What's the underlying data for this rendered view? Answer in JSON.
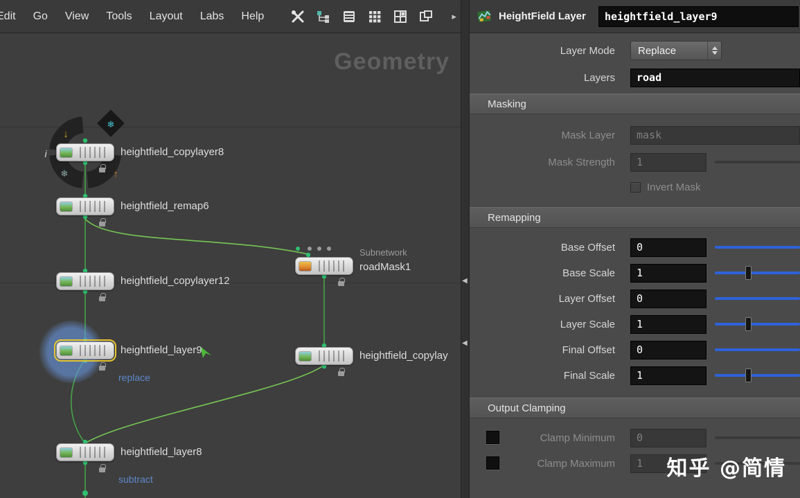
{
  "menu": {
    "items": [
      "Edit",
      "Go",
      "View",
      "Tools",
      "Layout",
      "Labs",
      "Help"
    ]
  },
  "icons": {
    "arrow_down": "↓",
    "arrow_up": "↑",
    "freeze": "❄",
    "info": "i",
    "overflow_chevron": "▸",
    "divider_arrow": "◀"
  },
  "network": {
    "watermark": "Geometry",
    "nodes": {
      "copylayer8": {
        "label": "heightfield_copylayer8"
      },
      "remap6": {
        "label": "heightfield_remap6"
      },
      "copylayer12": {
        "label": "heightfield_copylayer12"
      },
      "roadmask1": {
        "type_label": "Subnetwork",
        "label": "roadMask1"
      },
      "layer9": {
        "label": "heightfield_layer9",
        "mode_label": "replace"
      },
      "copylayer_right": {
        "label": "heightfield_copylay"
      },
      "layer8": {
        "label": "heightfield_layer8",
        "mode_label": "subtract"
      }
    }
  },
  "panel": {
    "title": "HeightField Layer",
    "node_name": "heightfield_layer9",
    "layer_mode": {
      "label": "Layer Mode",
      "value": "Replace"
    },
    "layers": {
      "label": "Layers",
      "value": "road"
    },
    "masking": {
      "title": "Masking",
      "mask_layer": {
        "label": "Mask Layer",
        "value": "mask"
      },
      "mask_strength": {
        "label": "Mask Strength",
        "value": "1"
      },
      "invert_mask": {
        "label": "Invert Mask"
      }
    },
    "remapping": {
      "title": "Remapping",
      "rows": [
        {
          "label": "Base Offset",
          "value": "0"
        },
        {
          "label": "Base Scale",
          "value": "1"
        },
        {
          "label": "Layer Offset",
          "value": "0"
        },
        {
          "label": "Layer Scale",
          "value": "1"
        },
        {
          "label": "Final Offset",
          "value": "0"
        },
        {
          "label": "Final Scale",
          "value": "1"
        }
      ]
    },
    "clamping": {
      "title": "Output Clamping",
      "rows": [
        {
          "label": "Clamp Minimum",
          "value": "0"
        },
        {
          "label": "Clamp Maximum",
          "value": "1"
        }
      ]
    }
  },
  "colors": {
    "slider_accent": "#2e62d9",
    "wire_green": "#46a349",
    "selection_yellow": "#e7c733"
  },
  "watermark": "知乎 @简情"
}
